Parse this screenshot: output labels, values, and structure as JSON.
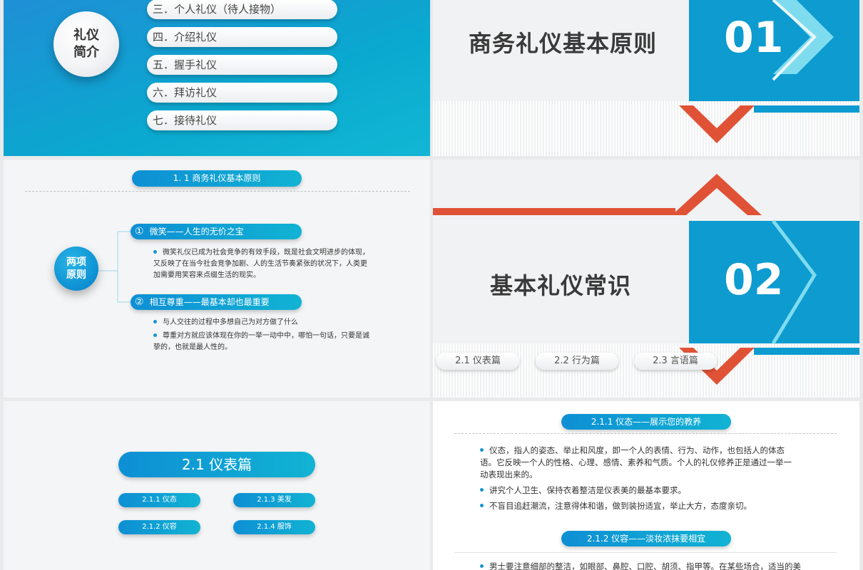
{
  "slide1": {
    "circle_label": "礼仪\n简介",
    "menu_items": [
      "三．个人礼仪（待人接物）",
      "四．介绍礼仪",
      "五．握手礼仪",
      "六．拜访礼仪",
      "七．接待礼仪"
    ]
  },
  "slide2": {
    "title": "商务礼仪基本原则",
    "number": "01"
  },
  "slide3": {
    "header": "1. 1  商务礼仪基本原则",
    "circle_label": "两项\n原则",
    "principle1": {
      "marker": "①",
      "label": "微笑——人生的无价之宝"
    },
    "principle1_bullets": [
      "微笑礼仪已成为社会竞争的有效手段，既是社会文明进步的体现，又反映了在当今社会竞争加剧、人的生活节奏紧张的状况下，人类更加需要用笑容来点缀生活的现实。"
    ],
    "principle2": {
      "marker": "②",
      "label": "相互尊重——最基本却也最重要"
    },
    "principle2_bullets": [
      "与人交往的过程中多想自己为对方做了什么",
      "尊重对方就应该体现在你的一举一动中中，哪怕一句话，只要是诚挚的，也就是最人性的。"
    ]
  },
  "slide4": {
    "title": "基本礼仪常识",
    "number": "02",
    "tabs": [
      "2.1  仪表篇",
      "2.2  行为篇",
      "2.3  言语篇"
    ]
  },
  "slide5": {
    "title": "2.1 仪表篇",
    "buttons": [
      "2.1.1 仪态",
      "2.1.3  美发",
      "2.1.2 仪容",
      "2.1.4  服饰"
    ]
  },
  "slide6": {
    "section1_header": "2.1.1  仪态——展示您的教养",
    "section1_bullets": [
      "仪态，指人的姿态、举止和风度，即一个人的表情、行为、动作，也包括人的体态语。它反映一个人的性格、心理、感情、素养和气质。个人的礼仪修养正是通过一举一动表现出来的。",
      "讲究个人卫生、保持衣着整洁是仪表美的最基本要求。",
      "不盲目追赶潮流，注意得体和谐，做到装扮适宜，举止大方，态度亲切。"
    ],
    "section2_header": "2.1.2  仪容——淡妆浓抹要相宜",
    "section2_bullets": [
      "男士要注意细部的整洁，如眼部、鼻腔、口腔、胡须、指甲等。在某些场合，适当的美"
    ]
  },
  "colors": {
    "blue": "#0d9bd0",
    "teal": "#0aa9cf",
    "red": "#e05236",
    "cyan_light": "#7fdcef"
  }
}
